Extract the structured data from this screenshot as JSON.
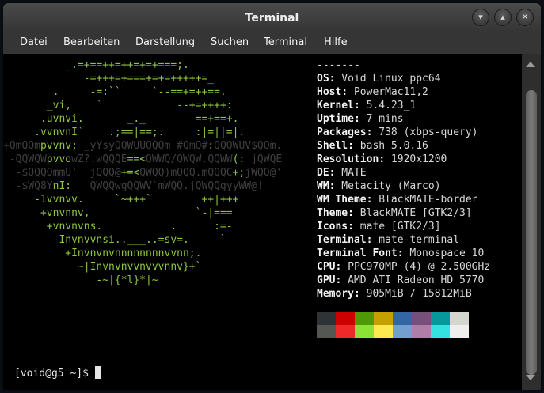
{
  "window": {
    "title": "Terminal"
  },
  "menu": [
    "Datei",
    "Bearbeiten",
    "Darstellung",
    "Suchen",
    "Terminal",
    "Hilfe"
  ],
  "logo_lines": [
    [
      [
        "g",
        "          _.=+==++=++=+=+===;."
      ]
    ],
    [
      [
        "g",
        "             -=+++=+===+=+=+++++=_"
      ]
    ],
    [
      [
        "g",
        "        .     -=:``     `--==+=++==."
      ]
    ],
    [
      [
        "g",
        "       _vi,    `            --+=++++:"
      ]
    ],
    [
      [
        "g",
        "      .uvnvi.       _._       -==+==+."
      ]
    ],
    [
      [
        "g",
        "     .vvnvnI`    .;==|==;.     :|=||=|."
      ]
    ],
    [
      [
        "l",
        "+QmQQm"
      ],
      [
        "g",
        "pvvnv;"
      ],
      [
        "l",
        " _yYsyQQWUUQQQm #QmQ#"
      ],
      [
        "g",
        ":"
      ],
      [
        "l",
        "QQQWUV$QQm."
      ]
    ],
    [
      [
        "l",
        " -QQWQW"
      ],
      [
        "g",
        "pvvo"
      ],
      [
        "l",
        "wZ?.wQQQE"
      ],
      [
        "g",
        "==<"
      ],
      [
        "l",
        "QWWQ/QWQW.QQWW"
      ],
      [
        "g",
        "(:"
      ],
      [
        "l",
        " jQWQE"
      ]
    ],
    [
      [
        "l",
        "  -$QQQQmmU'  jQQQ@"
      ],
      [
        "g",
        "+=<"
      ],
      [
        "l",
        "QWQQ)mQQQ.mQQQC"
      ],
      [
        "g",
        "+;"
      ],
      [
        "l",
        "jWQQ@'"
      ]
    ],
    [
      [
        "l",
        "  -$WQ8Y"
      ],
      [
        "g",
        "nI:"
      ],
      [
        "l",
        "   QWQQwgQQWV`mWQQ.jQWQQgyyWW@!"
      ]
    ],
    [
      [
        "g",
        "     -1vvnvv.     `~+++`        ++|+++"
      ]
    ],
    [
      [
        "g",
        "      +vnvnnv,                 `-|==="
      ]
    ],
    [
      [
        "g",
        "       +vnvnvns.           .      :=-"
      ]
    ],
    [
      [
        "g",
        "        -Invnvvnsi..___..=sv=.     `"
      ]
    ],
    [
      [
        "g",
        "          +Invnvnvnnnnnnnnvvnn;."
      ]
    ],
    [
      [
        "g",
        "            ~|Invnvnvvnvvvnnv}+`"
      ]
    ],
    [
      [
        "g",
        "               -~|{*l}*|~"
      ]
    ]
  ],
  "info": {
    "separator": "-------",
    "rows": [
      {
        "key": "OS",
        "value": "Void Linux ppc64"
      },
      {
        "key": "Host",
        "value": "PowerMac11,2"
      },
      {
        "key": "Kernel",
        "value": "5.4.23_1"
      },
      {
        "key": "Uptime",
        "value": "7 mins"
      },
      {
        "key": "Packages",
        "value": "738 (xbps-query)"
      },
      {
        "key": "Shell",
        "value": "bash 5.0.16"
      },
      {
        "key": "Resolution",
        "value": "1920x1200"
      },
      {
        "key": "DE",
        "value": "MATE"
      },
      {
        "key": "WM",
        "value": "Metacity (Marco)"
      },
      {
        "key": "WM Theme",
        "value": "BlackMATE-border"
      },
      {
        "key": "Theme",
        "value": "BlackMATE [GTK2/3]"
      },
      {
        "key": "Icons",
        "value": "mate [GTK2/3]"
      },
      {
        "key": "Terminal",
        "value": "mate-terminal"
      },
      {
        "key": "Terminal Font",
        "value": "Monospace 10"
      },
      {
        "key": "CPU",
        "value": "PPC970MP (4) @ 2.500GHz"
      },
      {
        "key": "GPU",
        "value": "AMD ATI Radeon HD 5770"
      },
      {
        "key": "Memory",
        "value": "905MiB / 15812MiB"
      }
    ]
  },
  "palette": {
    "normal": [
      "#2e3436",
      "#cc0000",
      "#4e9a06",
      "#c4a000",
      "#3465a4",
      "#75507b",
      "#06989a",
      "#d3d7cf"
    ],
    "bright": [
      "#555753",
      "#ef2929",
      "#8ae234",
      "#fce94f",
      "#729fcf",
      "#ad7fa8",
      "#34e2e2",
      "#eeeeec"
    ]
  },
  "prompt": "[void@g5 ~]$ ",
  "icons": {
    "minimize": "chevron-down-icon",
    "maximize": "chevron-up-icon",
    "close": "close-icon"
  }
}
